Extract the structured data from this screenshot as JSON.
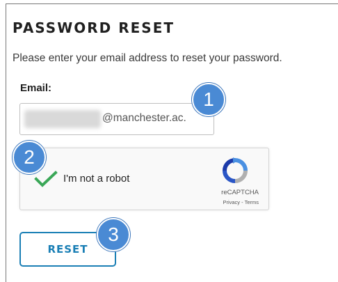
{
  "page": {
    "title": "PASSWORD RESET",
    "instructions": "Please enter your email address to reset your password."
  },
  "form": {
    "email_label": "Email:",
    "email_value_visible": "@manchester.ac.",
    "reset_label": "RESET"
  },
  "recaptcha": {
    "label": "I'm not a robot",
    "brand": "reCAPTCHA",
    "links": "Privacy - Terms",
    "checked": true
  },
  "annotations": {
    "step1": "1",
    "step2": "2",
    "step3": "3"
  },
  "colors": {
    "accent": "#1a7fb5",
    "marker": "#4a8ad4",
    "check": "#3aa757"
  }
}
